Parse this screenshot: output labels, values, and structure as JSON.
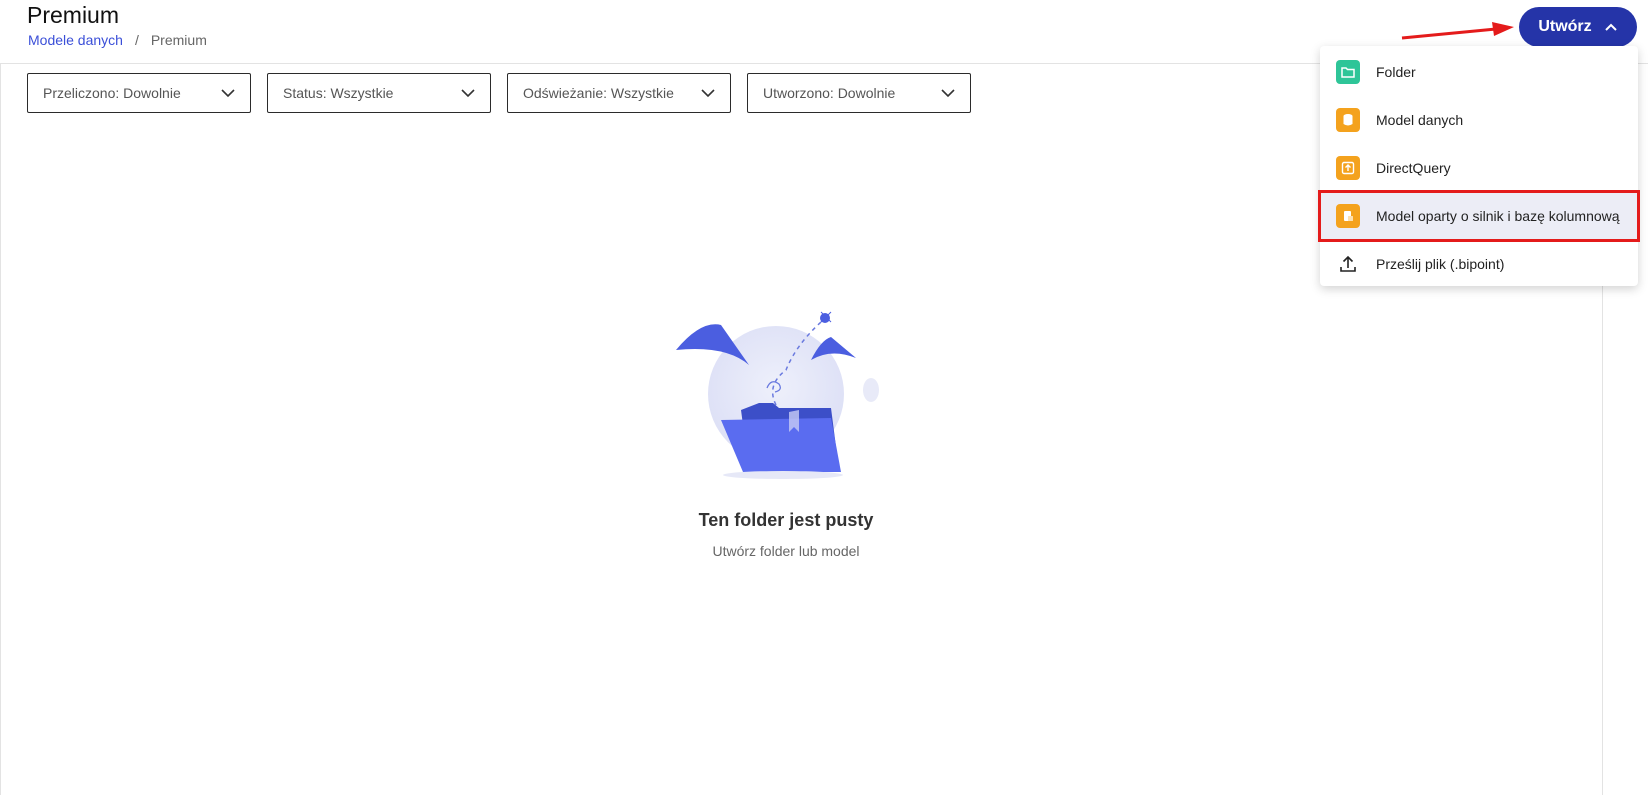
{
  "header": {
    "title": "Premium",
    "breadcrumb": [
      {
        "label": "Modele danych"
      },
      {
        "label": "Premium"
      }
    ],
    "breadcrumb_separator": "/"
  },
  "filters": [
    {
      "label": "Przeliczono: Dowolnie"
    },
    {
      "label": "Status: Wszystkie"
    },
    {
      "label": "Odświeżanie: Wszystkie"
    },
    {
      "label": "Utworzono: Dowolnie"
    }
  ],
  "empty_state": {
    "title": "Ten folder jest pusty",
    "subtitle": "Utwórz folder lub model"
  },
  "create_button": {
    "label": "Utwórz",
    "icon": "chevron-up-icon",
    "color": "#2534a8"
  },
  "create_menu": {
    "items": [
      {
        "label": "Folder",
        "icon": "folder-icon",
        "color": "#2ec598"
      },
      {
        "label": "Model danych",
        "icon": "database-icon",
        "color": "#f4a21d"
      },
      {
        "label": "DirectQuery",
        "icon": "direct-query-icon",
        "color": "#f4a21d"
      },
      {
        "label": "Model oparty o silnik i bazę kolumnową",
        "icon": "columnar-model-icon",
        "color": "#f4a21d",
        "highlighted": true
      },
      {
        "label": "Prześlij plik (.bipoint)",
        "icon": "upload-icon"
      }
    ]
  },
  "annotations": {
    "highlight_color": "#e41b1b"
  }
}
